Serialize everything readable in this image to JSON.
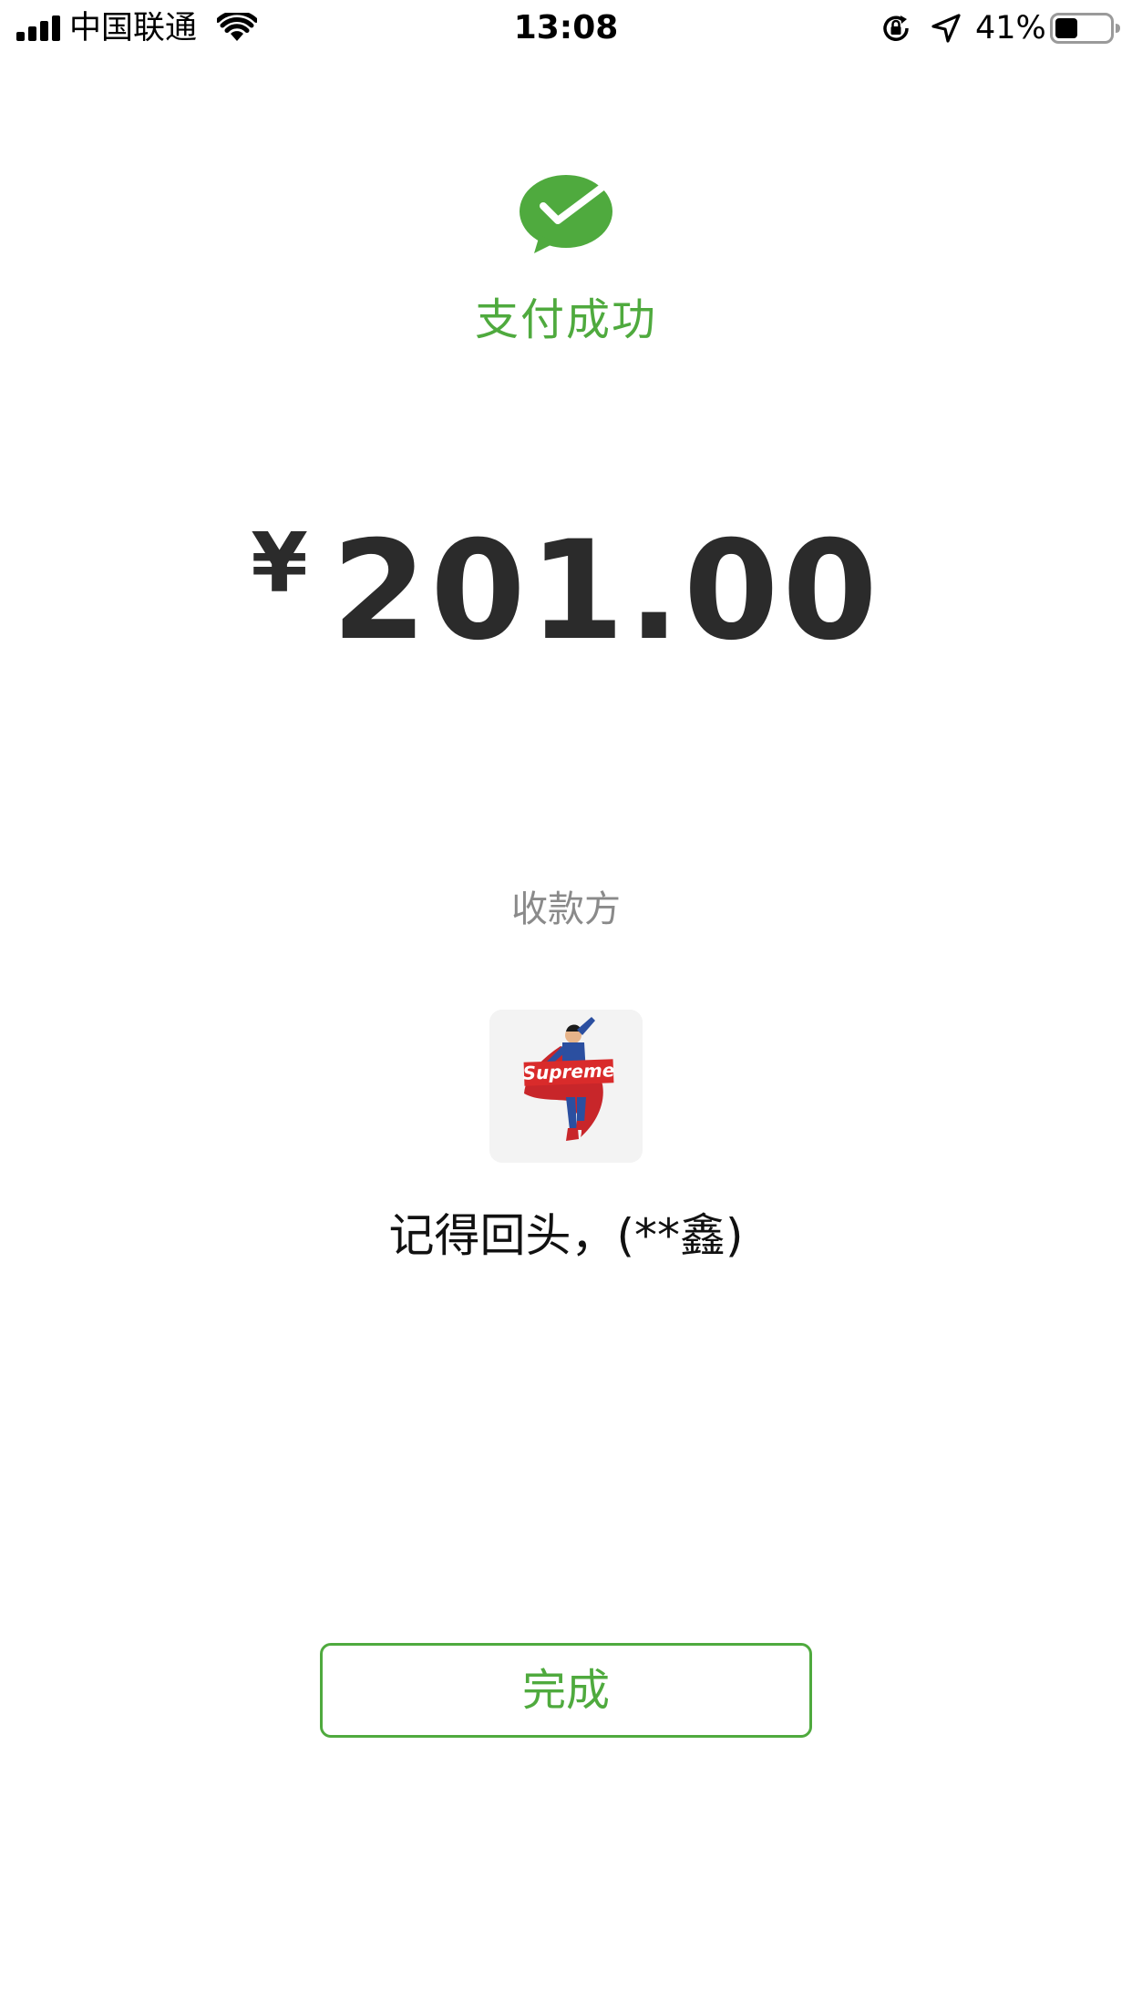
{
  "status_bar": {
    "carrier": "中国联通",
    "time": "13:08",
    "battery_percent": "41%",
    "battery_level": 0.41,
    "signal_bars": 4,
    "icons": [
      "signal-icon",
      "wifi-icon",
      "rotation-lock-icon",
      "location-arrow-icon",
      "battery-icon"
    ]
  },
  "payment": {
    "status_title": "支付成功",
    "currency_symbol": "¥",
    "amount": "201.00",
    "payee_label": "收款方",
    "payee_name": "记得回头，(**鑫)",
    "avatar_text": "Supreme",
    "logo_icon": "wechat-pay-icon"
  },
  "actions": {
    "done_label": "完成"
  },
  "colors": {
    "accent_green": "#4faa3e",
    "amount_text": "#2b2b2b",
    "muted_text": "#8a8a8a",
    "avatar_box_red": "#d92b2b"
  }
}
